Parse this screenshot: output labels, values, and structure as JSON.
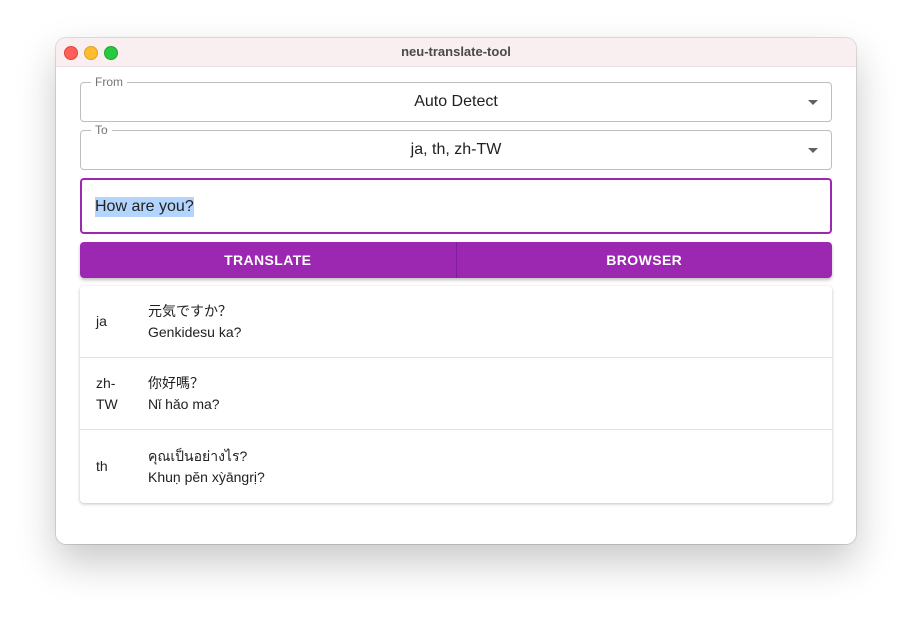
{
  "window": {
    "title": "neu-translate-tool"
  },
  "from": {
    "label": "From",
    "value": "Auto Detect"
  },
  "to": {
    "label": "To",
    "value": "ja, th, zh-TW"
  },
  "input": {
    "value": "How are you?"
  },
  "buttons": {
    "translate": "TRANSLATE",
    "browser": "BROWSER"
  },
  "colors": {
    "accent": "#9c27b0",
    "selection": "#b3d4fc"
  },
  "results": [
    {
      "lang": "ja",
      "text": "元気ですか？",
      "romanization": "Genkidesu ka?"
    },
    {
      "lang": "zh-TW",
      "text": "你好嗎？",
      "romanization": "Nǐ hǎo ma?"
    },
    {
      "lang": "th",
      "text": "คุณเป็นอย่างไร?",
      "romanization": "Khuṇ pĕn xỳāngrị?"
    }
  ]
}
